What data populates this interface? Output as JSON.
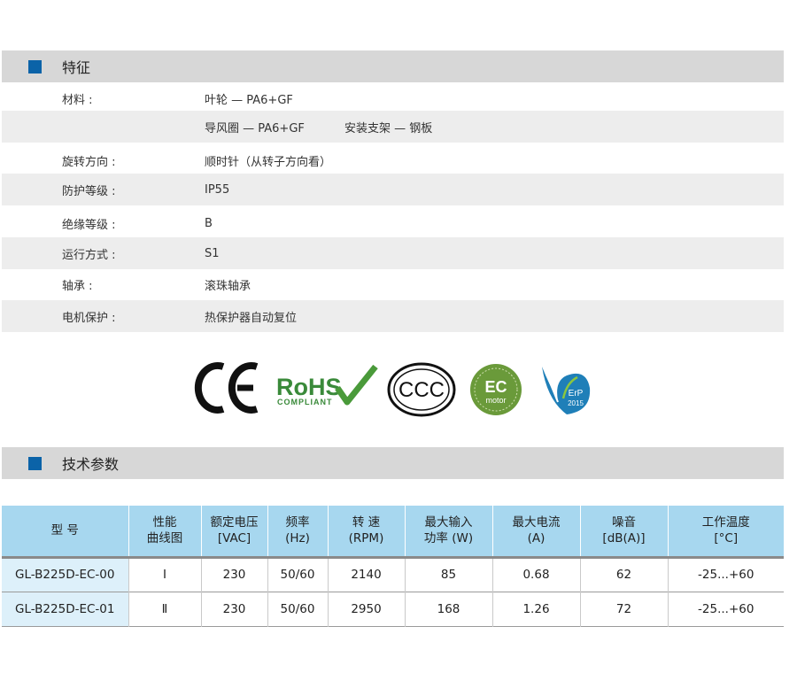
{
  "features": {
    "title": "特征",
    "rows": [
      {
        "label": "材料 :",
        "value": "叶轮 — PA6+GF",
        "value2": ""
      },
      {
        "label": "",
        "value": "导风圈 — PA6+GF",
        "value2": "安装支架 — 钢板"
      },
      {
        "label": "旋转方向 :",
        "value": "顺时针（从转子方向看）",
        "value2": ""
      },
      {
        "label": "防护等级 :",
        "value": "IP55",
        "value2": ""
      },
      {
        "label": "绝缘等级 :",
        "value": "B",
        "value2": ""
      },
      {
        "label": "运行方式 :",
        "value": "S1",
        "value2": ""
      },
      {
        "label": "轴承 :",
        "value": "滚珠轴承",
        "value2": ""
      },
      {
        "label": "电机保护 :",
        "value": "热保护器自动复位",
        "value2": ""
      }
    ]
  },
  "certifications": {
    "ce": "CE",
    "rohs": "RoHS",
    "rohs_sub": "COMPLIANT",
    "ccc": "CCC",
    "ec": "EC",
    "ec_sub": "motor",
    "erp": "ErP",
    "erp_year": "2015"
  },
  "tech": {
    "title": "技术参数",
    "headers": [
      [
        "型 号",
        ""
      ],
      [
        "性能",
        "曲线图"
      ],
      [
        "额定电压",
        "[VAC]"
      ],
      [
        "频率",
        "(Hz)"
      ],
      [
        "转 速",
        "(RPM)"
      ],
      [
        "最大输入",
        "功率 (W)"
      ],
      [
        "最大电流",
        "(A)"
      ],
      [
        "噪音",
        "[dB(A)]"
      ],
      [
        "工作温度",
        "[°C]"
      ]
    ],
    "rows": [
      [
        "GL-B225D-EC-00",
        "Ⅰ",
        "230",
        "50/60",
        "2140",
        "85",
        "0.68",
        "62",
        "-25...+60"
      ],
      [
        "GL-B225D-EC-01",
        "Ⅱ",
        "230",
        "50/60",
        "2950",
        "168",
        "1.26",
        "72",
        "-25...+60"
      ]
    ]
  },
  "colors": {
    "accent": "#0b63a8",
    "header_gray": "#d7d7d7",
    "row_shade": "#ededed",
    "table_header": "#a7d7ef",
    "model_cell": "#ddf0fa",
    "rohs_green": "#3a8a3a",
    "ec_green": "#6a9a3a",
    "erp_blue": "#1f7fb8"
  }
}
